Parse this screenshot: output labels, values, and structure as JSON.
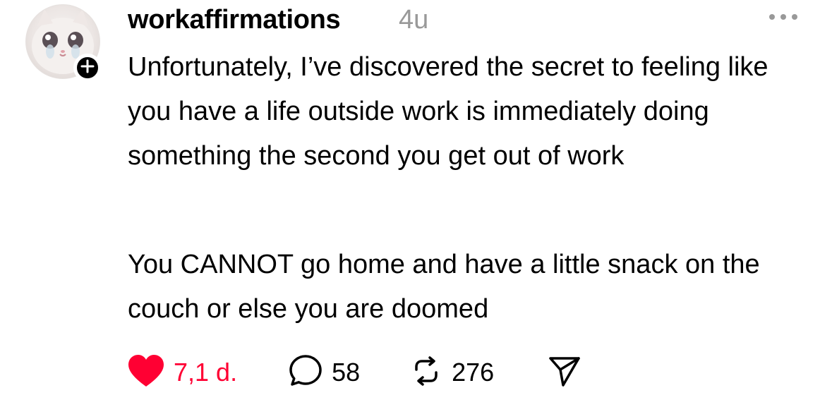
{
  "post": {
    "username": "workaffirmations",
    "timestamp": "4u",
    "paragraphs": [
      "Unfortunately, I’ve discovered the secret to feeling like you have a life outside work is immediately doing something the second you get out of work",
      "You CANNOT go home and have a little snack on the couch or else you are doomed"
    ],
    "actions": {
      "likes": "7,1 d.",
      "comments": "58",
      "reposts": "276"
    }
  },
  "icons": {
    "avatar": "crying-cat-avatar",
    "follow": "plus-icon",
    "more": "more-dots-icon",
    "like": "heart-icon",
    "comment": "comment-bubble-icon",
    "repost": "repost-arrows-icon",
    "share": "send-icon"
  },
  "colors": {
    "like": "#ff0033",
    "muted": "#999999",
    "text": "#000000"
  }
}
